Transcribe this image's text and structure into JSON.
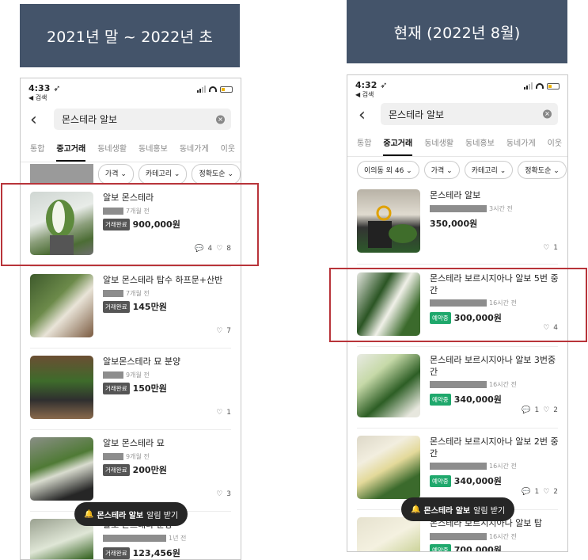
{
  "left": {
    "banner": "2021년 말 ~ 2022년 초",
    "time": "4:33",
    "back_label": "◀ 검색",
    "search_value": "몬스테라 알보",
    "tabs": [
      "통합",
      "중고거래",
      "동네생활",
      "동네홍보",
      "동네가게",
      "이웃"
    ],
    "filters": [
      "가격",
      "카테고리",
      "정확도순"
    ],
    "items": [
      {
        "title": "알보 몬스테라",
        "time": "7개월 전",
        "badge": "거래완료",
        "price": "900,000원",
        "chat": "4",
        "likes": "8"
      },
      {
        "title": "알보 몬스테라 탑수 하프문+산반",
        "time": "7개월 전",
        "badge": "거래완료",
        "price": "145만원",
        "likes": "7"
      },
      {
        "title": "알보몬스테라 묘 분양",
        "time": "9개월 전",
        "badge": "거래완료",
        "price": "150만원",
        "likes": "1"
      },
      {
        "title": "알보 몬스테라 묘",
        "time": "9개월 전",
        "badge": "거래완료",
        "price": "200만원",
        "likes": "3"
      },
      {
        "title": "알보 몬스테라 분양",
        "time": "1년 전",
        "badge": "거래완료",
        "price": "123,456원"
      }
    ],
    "toast_bold": "몬스테라 알보",
    "toast_rest": "알림 받기"
  },
  "right": {
    "banner": "현재 (2022년 8월)",
    "time": "4:32",
    "back_label": "◀ 검색",
    "search_value": "몬스테라 알보",
    "tabs": [
      "통합",
      "중고거래",
      "동네생활",
      "동네홍보",
      "동네가게",
      "이웃"
    ],
    "filters": [
      "이의동 외 46",
      "가격",
      "카테고리",
      "정확도순"
    ],
    "items": [
      {
        "title": "몬스테라 알보",
        "time": "3시간 전",
        "price": "350,000원",
        "likes": "1"
      },
      {
        "title": "몬스테라 보르시지아나 알보 5번 중간",
        "time": "16시간 전",
        "badge": "예약중",
        "price": "300,000원",
        "likes": "4"
      },
      {
        "title": "몬스테라 보르시지아나 알보 3번중간",
        "time": "16시간 전",
        "badge": "예약중",
        "price": "340,000원",
        "chat": "1",
        "likes": "2"
      },
      {
        "title": "몬스테라 보르시지아나 알보 2번 중간",
        "time": "16시간 전",
        "badge": "예약중",
        "price": "340,000원",
        "chat": "1",
        "likes": "2"
      },
      {
        "title": "몬스테라 보르시지아나 알보 탑",
        "time": "16시간 전",
        "badge": "예약중",
        "price": "700,000원"
      }
    ],
    "toast_bold": "몬스테라 알보",
    "toast_rest": "알림 받기"
  },
  "colors": {
    "banner": "#44546a",
    "highlight": "#b8343a",
    "badge_done": "#555555",
    "badge_reserved": "#1fa86c"
  }
}
